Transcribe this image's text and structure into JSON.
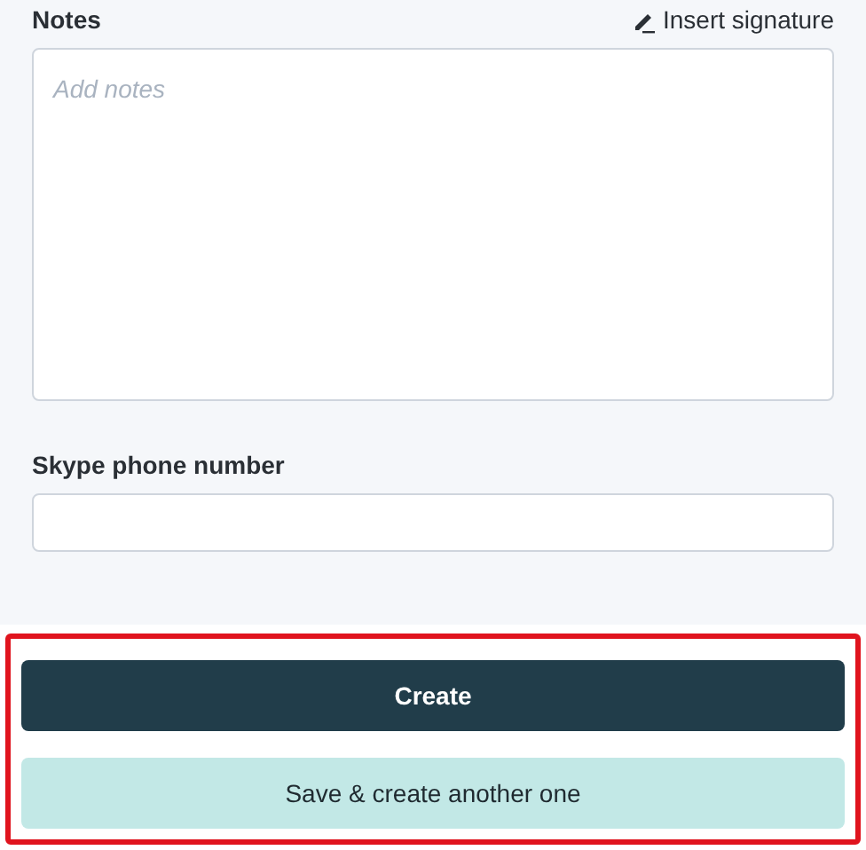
{
  "notes": {
    "label": "Notes",
    "link": "Insert signature",
    "placeholder": "Add notes"
  },
  "skype": {
    "label": "Skype phone number"
  },
  "footer": {
    "highlighted": true,
    "buttons": [
      {
        "label": "Create",
        "kind": "primary"
      },
      {
        "label": "Save & create another one",
        "kind": "secondary"
      }
    ]
  }
}
